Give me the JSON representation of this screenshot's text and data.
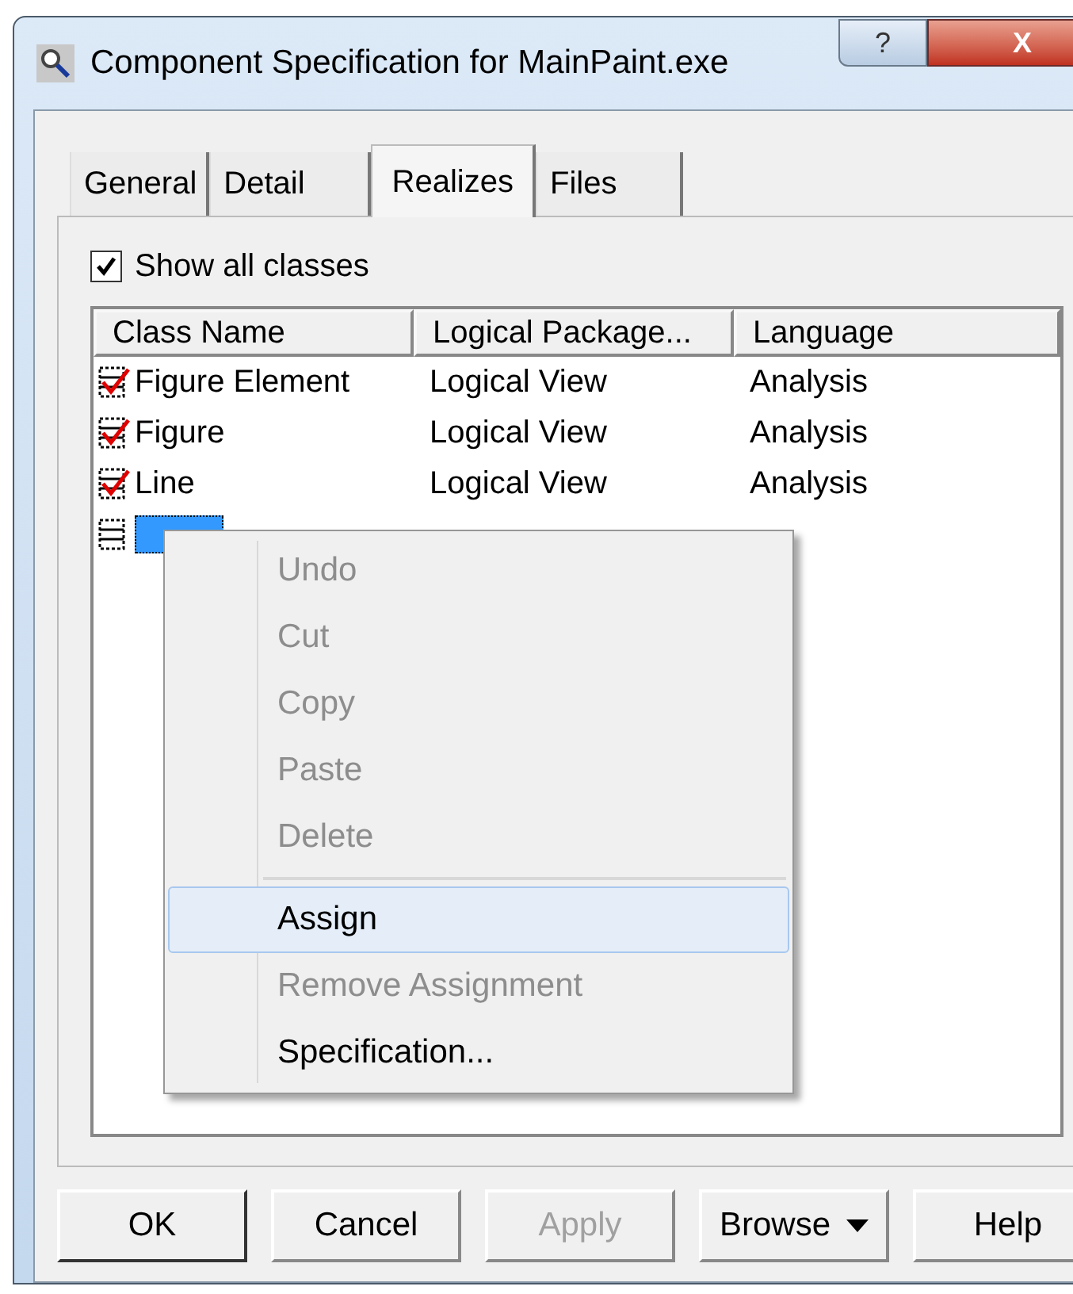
{
  "window": {
    "title": "Component Specification for MainPaint.exe",
    "help_button": "?",
    "close_button": "X"
  },
  "tabs": [
    {
      "label": "General",
      "selected": false
    },
    {
      "label": "Detail",
      "selected": false
    },
    {
      "label": "Realizes",
      "selected": true
    },
    {
      "label": "Files",
      "selected": false
    }
  ],
  "show_all_classes": {
    "label": "Show all classes",
    "checked": true
  },
  "table": {
    "columns": [
      "Class Name",
      "Logical Package...",
      "Language"
    ],
    "rows": [
      {
        "assigned": true,
        "selected": false,
        "cells": [
          "Figure Element",
          "Logical View",
          "Analysis"
        ]
      },
      {
        "assigned": true,
        "selected": false,
        "cells": [
          "Figure",
          "Logical View",
          "Analysis"
        ]
      },
      {
        "assigned": true,
        "selected": false,
        "cells": [
          "Line",
          "Logical View",
          "Analysis"
        ]
      },
      {
        "assigned": false,
        "selected": true,
        "cells": []
      }
    ]
  },
  "context_menu": [
    {
      "label": "Undo",
      "disabled": true,
      "selected": false
    },
    {
      "label": "Cut",
      "disabled": true,
      "selected": false
    },
    {
      "label": "Copy",
      "disabled": true,
      "selected": false
    },
    {
      "label": "Paste",
      "disabled": true,
      "selected": false
    },
    {
      "label": "Delete",
      "disabled": true,
      "selected": false
    },
    {
      "kind": "separator"
    },
    {
      "label": "Assign",
      "disabled": false,
      "selected": true
    },
    {
      "label": "Remove Assignment",
      "disabled": true,
      "selected": false
    },
    {
      "label": "Specification...",
      "disabled": false,
      "selected": false
    }
  ],
  "buttons": [
    {
      "label": "OK",
      "disabled": false,
      "default": true
    },
    {
      "label": "Cancel",
      "disabled": false,
      "default": false
    },
    {
      "label": "Apply",
      "disabled": true,
      "default": false
    },
    {
      "label": "Browse",
      "disabled": false,
      "default": false,
      "dropdown": true
    },
    {
      "label": "Help",
      "disabled": false,
      "default": false
    }
  ]
}
